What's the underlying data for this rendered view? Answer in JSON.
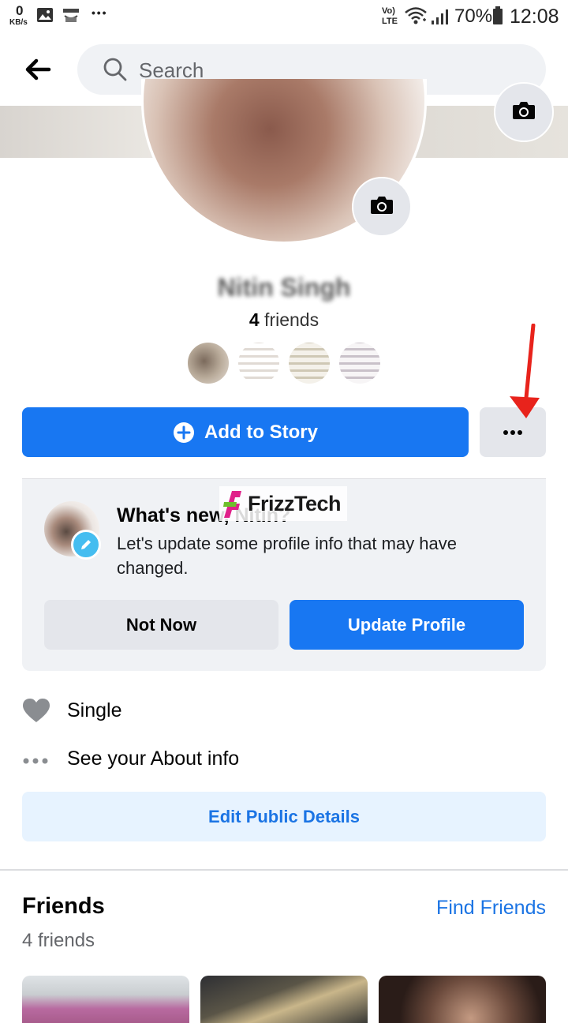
{
  "status_bar": {
    "speed_value": "0",
    "speed_unit": "KB/s",
    "overflow_dots": "• • •",
    "battery_percent": "70%",
    "time": "12:08",
    "network_label_top": "Vo)",
    "network_label_bottom": "LTE"
  },
  "header": {
    "search_placeholder": "Search"
  },
  "profile": {
    "name": "Nitin Singh",
    "friends_count_number": "4",
    "friends_count_label": " friends"
  },
  "actions": {
    "add_story_label": "Add to Story"
  },
  "whats_new_card": {
    "title": "What's new, Nitin?",
    "body": "Let's update some profile info that may have changed.",
    "not_now_label": "Not Now",
    "update_profile_label": "Update Profile"
  },
  "watermark_text": "FrizzTech",
  "info": {
    "relationship": "Single",
    "see_about": "See your About info",
    "edit_public_details": "Edit Public Details"
  },
  "friends_section": {
    "heading": "Friends",
    "find_friends": "Find Friends",
    "count_text": "4 friends"
  },
  "colors": {
    "brand_blue": "#1877f2",
    "link_blue": "#1b74e4",
    "light_blue_bg": "#e7f3ff",
    "card_bg": "#f0f2f5",
    "annotation_red": "#e8231c"
  }
}
